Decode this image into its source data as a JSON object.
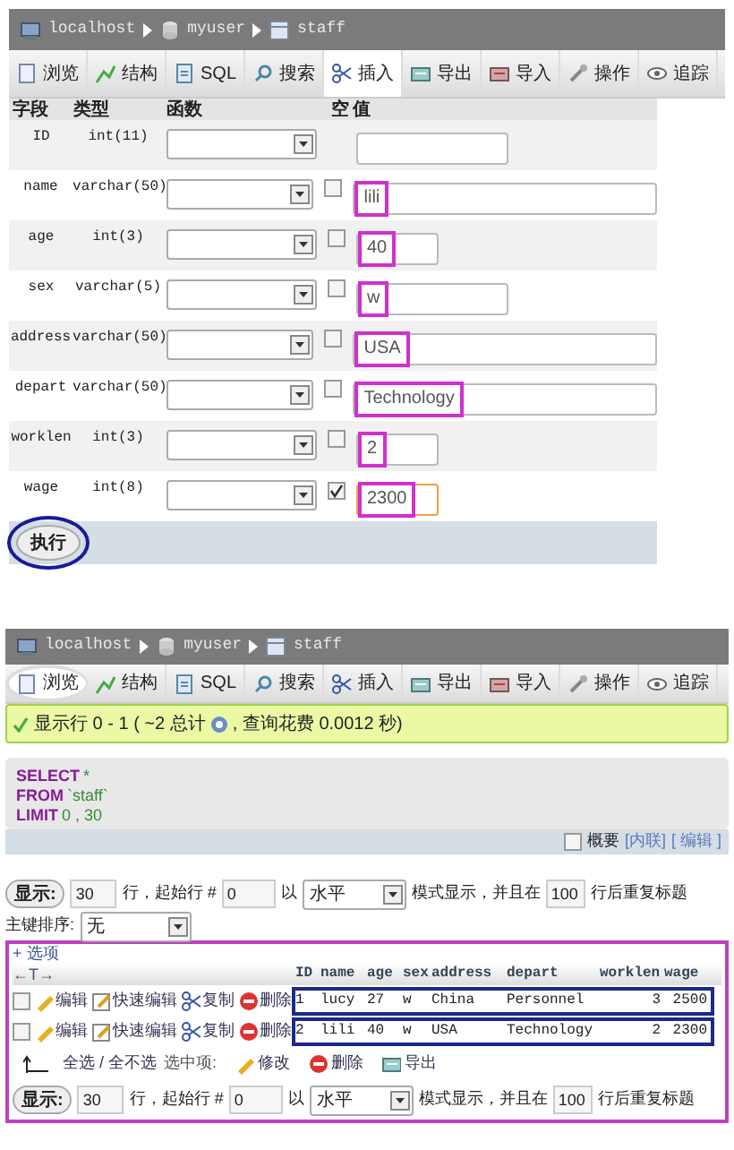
{
  "insert_view": {
    "breadcrumb": [
      {
        "kind": "server",
        "label": "localhost"
      },
      {
        "kind": "database",
        "label": "myuser"
      },
      {
        "kind": "table",
        "label": "staff"
      }
    ],
    "tabs": [
      {
        "label": "浏览",
        "selected": false,
        "circled": false
      },
      {
        "label": "结构",
        "selected": false,
        "circled": false
      },
      {
        "label": "SQL",
        "selected": false,
        "circled": false
      },
      {
        "label": "搜索",
        "selected": false,
        "circled": false
      },
      {
        "label": "插入",
        "selected": true,
        "circled": false
      },
      {
        "label": "导出",
        "selected": false,
        "circled": false
      },
      {
        "label": "导入",
        "selected": false,
        "circled": false
      },
      {
        "label": "操作",
        "selected": false,
        "circled": false
      },
      {
        "label": "追踪",
        "selected": false,
        "circled": false
      }
    ],
    "columns": [
      "字段",
      "类型",
      "函数",
      "空",
      "值"
    ],
    "rows": [
      {
        "field": "ID",
        "type": "int(11)",
        "nullable": false,
        "kind": "medium",
        "focused": false
      },
      {
        "field": "name",
        "type": "varchar(50)",
        "nullable": true,
        "null_checked": false,
        "value": "lili",
        "kind": "long",
        "highlighted": true,
        "focused": false
      },
      {
        "field": "age",
        "type": "int(3)",
        "nullable": true,
        "null_checked": false,
        "value": "40",
        "kind": "short",
        "highlighted": true,
        "focused": false
      },
      {
        "field": "sex",
        "type": "varchar(5)",
        "nullable": true,
        "null_checked": false,
        "value": "w",
        "kind": "medium",
        "highlighted": true,
        "focused": false
      },
      {
        "field": "address",
        "type": "varchar(50)",
        "nullable": true,
        "null_checked": false,
        "value": "USA",
        "kind": "long",
        "highlighted": true,
        "focused": false
      },
      {
        "field": "depart",
        "type": "varchar(50)",
        "nullable": true,
        "null_checked": false,
        "value": "Technology",
        "kind": "long",
        "highlighted": true,
        "focused": false
      },
      {
        "field": "worklen",
        "type": "int(3)",
        "nullable": true,
        "null_checked": false,
        "value": "2",
        "kind": "short",
        "highlighted": true,
        "focused": false
      },
      {
        "field": "wage",
        "type": "int(8)",
        "nullable": true,
        "null_checked": true,
        "value": "2300",
        "kind": "short",
        "highlighted": true,
        "focused": true
      }
    ],
    "go_button": {
      "label": "执行",
      "circled": true
    }
  },
  "browse_view": {
    "breadcrumb": [
      {
        "kind": "server",
        "label": "localhost"
      },
      {
        "kind": "database",
        "label": "myuser"
      },
      {
        "kind": "table",
        "label": "staff"
      }
    ],
    "tabs": [
      {
        "label": "浏览",
        "selected": true,
        "circled": true
      },
      {
        "label": "结构",
        "selected": false,
        "circled": false
      },
      {
        "label": "SQL",
        "selected": false,
        "circled": false
      },
      {
        "label": "搜索",
        "selected": false,
        "circled": false
      },
      {
        "label": "插入",
        "selected": false,
        "circled": false
      },
      {
        "label": "导出",
        "selected": false,
        "circled": false
      },
      {
        "label": "导入",
        "selected": false,
        "circled": false
      },
      {
        "label": "操作",
        "selected": false,
        "circled": false
      },
      {
        "label": "追踪",
        "selected": false,
        "circled": false
      }
    ],
    "success_message": "显示行 0 - 1 ( ~2 总计",
    "success_message_end": ", 查询花费 0.0012 秒)",
    "sql_lines": [
      {
        "keyword": "SELECT",
        "rest": "*"
      },
      {
        "keyword": "FROM",
        "rest": "`staff`"
      },
      {
        "keyword": "LIMIT",
        "rest": "0 , 30"
      }
    ],
    "sql_footer": {
      "profiling_label": "概要",
      "profiling_checked": false,
      "inline_link": "[内联]",
      "edit_link": "[ 编辑 ]"
    },
    "display_controls": {
      "button": "显示:",
      "rows": "30",
      "text_1": "行，起始行 #",
      "start": "0",
      "text_2": "以",
      "mode": "水平",
      "text_3": "模式显示，并且在",
      "repeat": "100",
      "text_4": "行后重复标题"
    },
    "sort": {
      "label": "主键排序:",
      "value": "无"
    },
    "options_link": "+ 选项",
    "column_arrows": "←T→",
    "columns": [
      "ID",
      "name",
      "age",
      "sex",
      "address",
      "depart",
      "worklen",
      "wage"
    ],
    "rows": [
      {
        "checked": false,
        "actions": [
          "编辑",
          "快速编辑",
          "复制",
          "删除"
        ],
        "cells": [
          "1",
          "lucy",
          "27",
          "w",
          "China",
          "Personnel",
          "3",
          "2500"
        ]
      },
      {
        "checked": false,
        "actions": [
          "编辑",
          "快速编辑",
          "复制",
          "删除"
        ],
        "cells": [
          "2",
          "lili",
          "40",
          "w",
          "USA",
          "Technology",
          "2",
          "2300"
        ]
      }
    ],
    "bulk": {
      "select_all": "全选 / 全不选",
      "with_selected": "选中项:",
      "actions": [
        "修改",
        "删除",
        "导出"
      ]
    },
    "display_controls_bottom": {
      "button": "显示:",
      "rows": "30",
      "text_1": "行，起始行 #",
      "start": "0",
      "text_2": "以",
      "mode": "水平",
      "text_3": "模式显示，并且在",
      "repeat": "100",
      "text_4": "行后重复标题"
    }
  }
}
